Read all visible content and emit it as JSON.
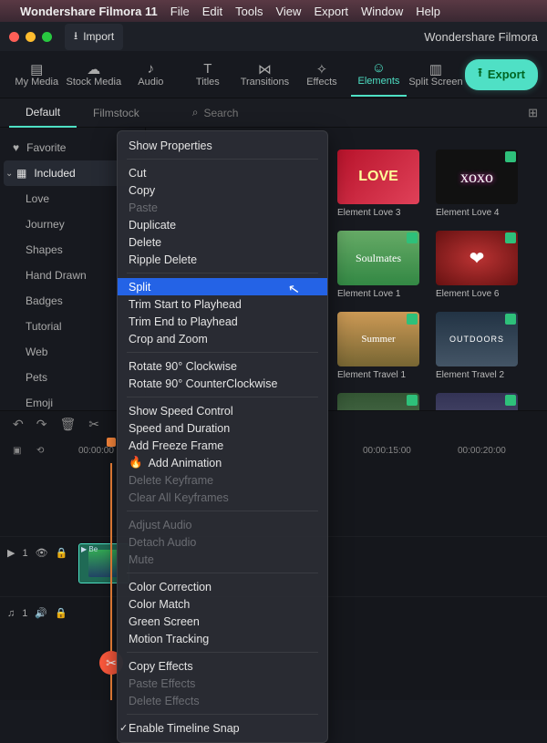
{
  "menubar": {
    "app": "Wondershare Filmora 11",
    "items": [
      "File",
      "Edit",
      "Tools",
      "View",
      "Export",
      "Window",
      "Help"
    ]
  },
  "titlebar": {
    "import": "Import",
    "brand": "Wondershare Filmora"
  },
  "maintabs": {
    "items": [
      "My Media",
      "Stock Media",
      "Audio",
      "Titles",
      "Transitions",
      "Effects",
      "Elements",
      "Split Screen"
    ],
    "active": 6,
    "export": "Export"
  },
  "subtabs": {
    "items": [
      "Default",
      "Filmstock"
    ],
    "active": 0,
    "search_placeholder": "Search"
  },
  "sidebar": {
    "favorite": "Favorite",
    "included": "Included",
    "cats": [
      "Love",
      "Journey",
      "Shapes",
      "Hand Drawn",
      "Badges",
      "Tutorial",
      "Web",
      "Pets",
      "Emoji"
    ]
  },
  "thumbs": {
    "r0": [
      {
        "label": "Element Love 3"
      },
      {
        "label": "Element Love 4"
      }
    ],
    "r1": [
      {
        "label": "Element Love 1"
      },
      {
        "label": "Element Love 6"
      }
    ],
    "r2": [
      {
        "label": "Element Travel 1"
      },
      {
        "label": "Element Travel 2"
      }
    ]
  },
  "timeline": {
    "start": "00:00:00",
    "t1": "00:00:15:00",
    "t2": "00:00:20:00",
    "track_v": "1",
    "track_a": "1"
  },
  "ctx": {
    "show_properties": "Show Properties",
    "cut": "Cut",
    "copy": "Copy",
    "paste": "Paste",
    "duplicate": "Duplicate",
    "delete": "Delete",
    "ripple_delete": "Ripple Delete",
    "split": "Split",
    "trim_start": "Trim Start to Playhead",
    "trim_end": "Trim End to Playhead",
    "crop_zoom": "Crop and Zoom",
    "rot_cw": "Rotate 90° Clockwise",
    "rot_ccw": "Rotate 90° CounterClockwise",
    "speed_ctrl": "Show Speed Control",
    "speed_dur": "Speed and Duration",
    "freeze": "Add Freeze Frame",
    "add_anim": "Add Animation",
    "del_kf": "Delete Keyframe",
    "clr_kf": "Clear All Keyframes",
    "adj_audio": "Adjust Audio",
    "detach_audio": "Detach Audio",
    "mute": "Mute",
    "color_corr": "Color Correction",
    "color_match": "Color Match",
    "green": "Green Screen",
    "motion": "Motion Tracking",
    "copy_fx": "Copy Effects",
    "paste_fx": "Paste Effects",
    "del_fx": "Delete Effects",
    "snap": "Enable Timeline Snap"
  }
}
